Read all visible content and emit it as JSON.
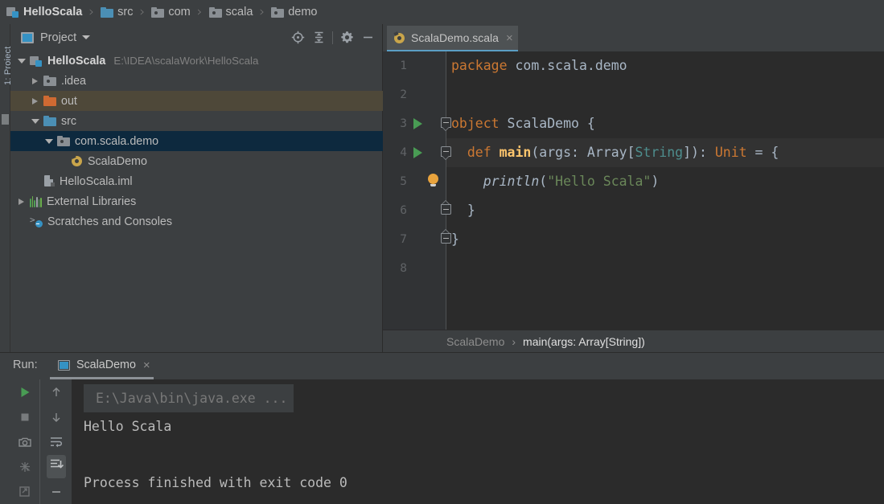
{
  "navbar": {
    "crumbs": [
      {
        "label": "HelloScala",
        "icon": "module-icon",
        "bold": true
      },
      {
        "label": "src",
        "icon": "folder-blue-icon",
        "bold": false
      },
      {
        "label": "com",
        "icon": "folder-grey-icon",
        "bold": false
      },
      {
        "label": "scala",
        "icon": "folder-grey-icon",
        "bold": false
      },
      {
        "label": "demo",
        "icon": "folder-grey-icon",
        "bold": false
      }
    ],
    "separator": "›"
  },
  "left_strip": {
    "label": "1: Project"
  },
  "project_panel": {
    "title": "Project",
    "actions": [
      {
        "name": "locate-icon",
        "title": "Select Opened File"
      },
      {
        "name": "collapse-all-icon",
        "title": "Collapse All"
      },
      {
        "name": "gear-icon",
        "title": "Settings"
      },
      {
        "name": "minimize-icon",
        "title": "Hide"
      }
    ],
    "tree": [
      {
        "label": "HelloScala",
        "path": "E:\\IDEA\\scalaWork\\HelloScala",
        "icon": "module-icon",
        "arrow": "down",
        "indent": 0,
        "bold": true,
        "state": "normal"
      },
      {
        "label": ".idea",
        "path": "",
        "icon": "folder-grey-icon",
        "arrow": "right",
        "indent": 1,
        "bold": false,
        "state": "normal"
      },
      {
        "label": "out",
        "path": "",
        "icon": "folder-orange-icon",
        "arrow": "right",
        "indent": 1,
        "bold": false,
        "state": "highlight"
      },
      {
        "label": "src",
        "path": "",
        "icon": "folder-blue-icon",
        "arrow": "down",
        "indent": 1,
        "bold": false,
        "state": "normal"
      },
      {
        "label": "com.scala.demo",
        "path": "",
        "icon": "package-icon",
        "arrow": "down",
        "indent": 2,
        "bold": false,
        "state": "selected"
      },
      {
        "label": "ScalaDemo",
        "path": "",
        "icon": "scala-object-icon",
        "arrow": "none",
        "indent": 3,
        "bold": false,
        "state": "normal"
      },
      {
        "label": "HelloScala.iml",
        "path": "",
        "icon": "iml-file-icon",
        "arrow": "none",
        "indent": 1,
        "bold": false,
        "state": "normal"
      },
      {
        "label": "External Libraries",
        "path": "",
        "icon": "libraries-icon",
        "arrow": "right",
        "indent": 0,
        "bold": false,
        "state": "normal"
      },
      {
        "label": "Scratches and Consoles",
        "path": "",
        "icon": "scratches-icon",
        "arrow": "none",
        "indent": 0,
        "bold": false,
        "state": "normal"
      }
    ]
  },
  "editor": {
    "tab": {
      "name": "ScalaDemo.scala",
      "icon": "scala-object-icon",
      "close": "×"
    },
    "lines": [
      {
        "num": "1",
        "runmark": false,
        "bulb": false,
        "fold": "none",
        "caret": false,
        "tokens": [
          {
            "t": "package ",
            "c": "kw"
          },
          {
            "t": "com.scala.demo",
            "c": "plain"
          }
        ]
      },
      {
        "num": "2",
        "runmark": false,
        "bulb": false,
        "fold": "none",
        "caret": false,
        "tokens": []
      },
      {
        "num": "3",
        "runmark": true,
        "bulb": false,
        "fold": "top",
        "caret": false,
        "tokens": [
          {
            "t": "object ",
            "c": "kw"
          },
          {
            "t": "ScalaDemo {",
            "c": "plain"
          }
        ]
      },
      {
        "num": "4",
        "runmark": true,
        "bulb": false,
        "fold": "top",
        "caret": true,
        "tokens": [
          {
            "t": "  def ",
            "c": "kw"
          },
          {
            "t": "main",
            "c": "fn"
          },
          {
            "t": "(args: Array[",
            "c": "plain"
          },
          {
            "t": "String",
            "c": "ty"
          },
          {
            "t": "]): ",
            "c": "plain"
          },
          {
            "t": "Unit",
            "c": "kw"
          },
          {
            "t": " = {",
            "c": "plain"
          }
        ]
      },
      {
        "num": "5",
        "runmark": false,
        "bulb": true,
        "fold": "none",
        "caret": false,
        "tokens": [
          {
            "t": "    println",
            "c": "mth"
          },
          {
            "t": "(",
            "c": "plain"
          },
          {
            "t": "\"Hello Scala\"",
            "c": "str"
          },
          {
            "t": ")",
            "c": "plain"
          }
        ]
      },
      {
        "num": "6",
        "runmark": false,
        "bulb": false,
        "fold": "bot",
        "caret": false,
        "tokens": [
          {
            "t": "  }",
            "c": "plain"
          }
        ]
      },
      {
        "num": "7",
        "runmark": false,
        "bulb": false,
        "fold": "bot",
        "caret": false,
        "tokens": [
          {
            "t": "}",
            "c": "plain"
          }
        ]
      },
      {
        "num": "8",
        "runmark": false,
        "bulb": false,
        "fold": "none",
        "caret": false,
        "tokens": []
      }
    ],
    "breadcrumb": {
      "first": "ScalaDemo",
      "separator": "›",
      "second": "main(args: Array[String])"
    }
  },
  "run_panel": {
    "label": "Run:",
    "tab": {
      "name": "ScalaDemo",
      "close": "×"
    },
    "tools_left": [
      {
        "name": "rerun-icon"
      },
      {
        "name": "stop-icon"
      },
      {
        "name": "screenshot-icon"
      },
      {
        "name": "debug-stacktrace-icon"
      },
      {
        "name": "export-icon"
      }
    ],
    "tools_right": [
      {
        "name": "up-arrow-icon"
      },
      {
        "name": "down-arrow-icon"
      },
      {
        "name": "soft-wrap-icon"
      },
      {
        "name": "scroll-to-end-icon",
        "active": true
      },
      {
        "name": "clear-all-icon"
      }
    ],
    "console": [
      {
        "text": "E:\\Java\\bin\\java.exe ...",
        "style": "cmd"
      },
      {
        "text": "Hello Scala",
        "style": "out"
      },
      {
        "text": "",
        "style": "out"
      },
      {
        "text": "Process finished with exit code 0",
        "style": "out"
      }
    ]
  },
  "colors": {
    "background": "#3c3f41",
    "editor_background": "#2b2b2b",
    "gutter": "#313335",
    "selection": "#0d293e",
    "highlight_row": "#4e4839",
    "accent_blue": "#3592c4",
    "keyword_orange": "#cc7832",
    "string_green": "#6a8759",
    "method_yellow": "#ffc66d",
    "type_teal": "#4e8e8e",
    "text": "#a9b7c6",
    "run_green": "#499c54"
  }
}
